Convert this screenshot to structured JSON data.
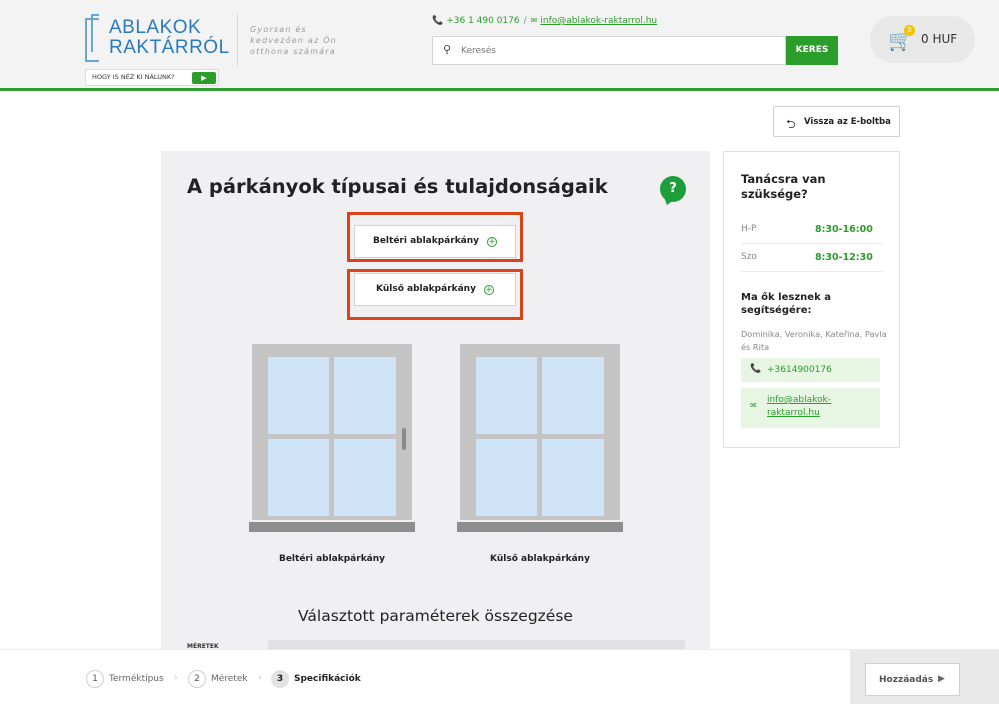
{
  "header": {
    "logo_line1": "ABLAKOK",
    "logo_line2": "RAKTÁRRÓL",
    "tagline": "Gyorsan és kedvezően az Ön otthona számára",
    "how_label": "HOGY IS NÉZ KI NÁLUNK?",
    "phone": "+36 1 490 0176",
    "email": "info@ablakok-raktarrol.hu",
    "search_placeholder": "Keresés",
    "search_button": "KERES",
    "cart_count": "0",
    "cart_amount": "0 HUF"
  },
  "back_button": "Vissza az E-boltba",
  "main": {
    "title": "A párkányok típusai és tulajdonságaik",
    "help": "?",
    "options": [
      {
        "label": "Beltéri ablakpárkány"
      },
      {
        "label": "Külső ablakpárkány"
      }
    ],
    "captions": [
      "Beltéri ablakpárkány",
      "Külső ablakpárkány"
    ],
    "summary_title": "Választott paraméterek összegzése",
    "summary_label": "MÉRETEK"
  },
  "sidebar": {
    "title": "Tanácsra van szüksége?",
    "hours": [
      {
        "day": "H-P",
        "time": "8:30-16:00"
      },
      {
        "day": "Szo",
        "time": "8:30-12:30"
      }
    ],
    "sub_title": "Ma ők lesznek a segítségére:",
    "names": "Dominika, Veronika, Kateřina, Pavla és Rita",
    "phone": "+3614900176",
    "email": "info@ablakok-raktarrol.hu"
  },
  "steps": [
    {
      "num": "1",
      "label": "Terméktípus"
    },
    {
      "num": "2",
      "label": "Méretek"
    },
    {
      "num": "3",
      "label": "Specifikációk"
    }
  ],
  "add_button": "Hozzáadás",
  "colors": {
    "accent_green": "#2a9d2a",
    "highlight_red": "#d9441a",
    "logo_blue": "#2a7ac1"
  }
}
